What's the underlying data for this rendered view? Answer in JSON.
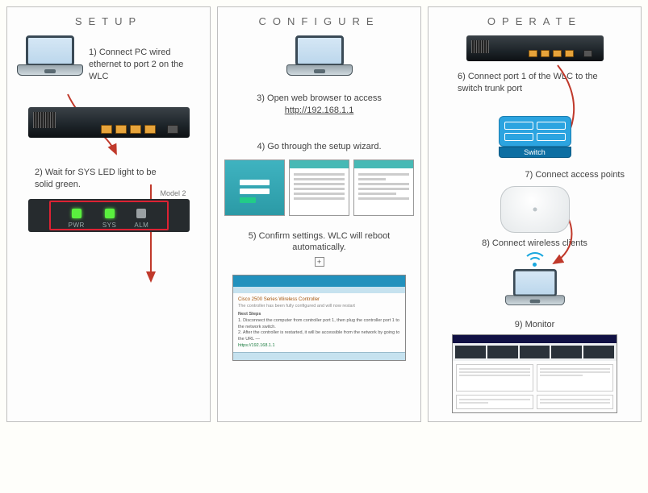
{
  "panels": {
    "setup": {
      "title": "SETUP",
      "step1": "1) Connect PC wired ethernet to port 2 on the WLC",
      "step2": "2) Wait for SYS LED light to be solid green.",
      "model_label": "Model 2",
      "leds": {
        "pwr": "PWR",
        "sys": "SYS",
        "alm": "ALM"
      }
    },
    "configure": {
      "title": "CONFIGURE",
      "step3_a": "3) Open web browser to access",
      "step3_url": "http://192.168.1.1",
      "step4": "4) Go through the setup wizard.",
      "step5": "5) Confirm settings.  WLC will reboot automatically.",
      "confirm_header": "Cisco 2500 Series Wireless Controller",
      "confirm_note": "The controller has been fully configured and will now restart",
      "confirm_heading": "Next Steps",
      "confirm_body1": "1. Disconnect the computer from controller port 1, then plug the controller port 1 to the network switch.",
      "confirm_body2": "2. After the controller is restarted, it will be accessible from the network by going to the URL —",
      "confirm_link": "https://192.168.1.1"
    },
    "operate": {
      "title": "OPERATE",
      "step6": "6) Connect port 1 of the WLC to the switch trunk port",
      "switch_label": "Switch",
      "step7": "7) Connect access points",
      "step8": "8) Connect wireless clients",
      "step9": "9) Monitor"
    }
  }
}
